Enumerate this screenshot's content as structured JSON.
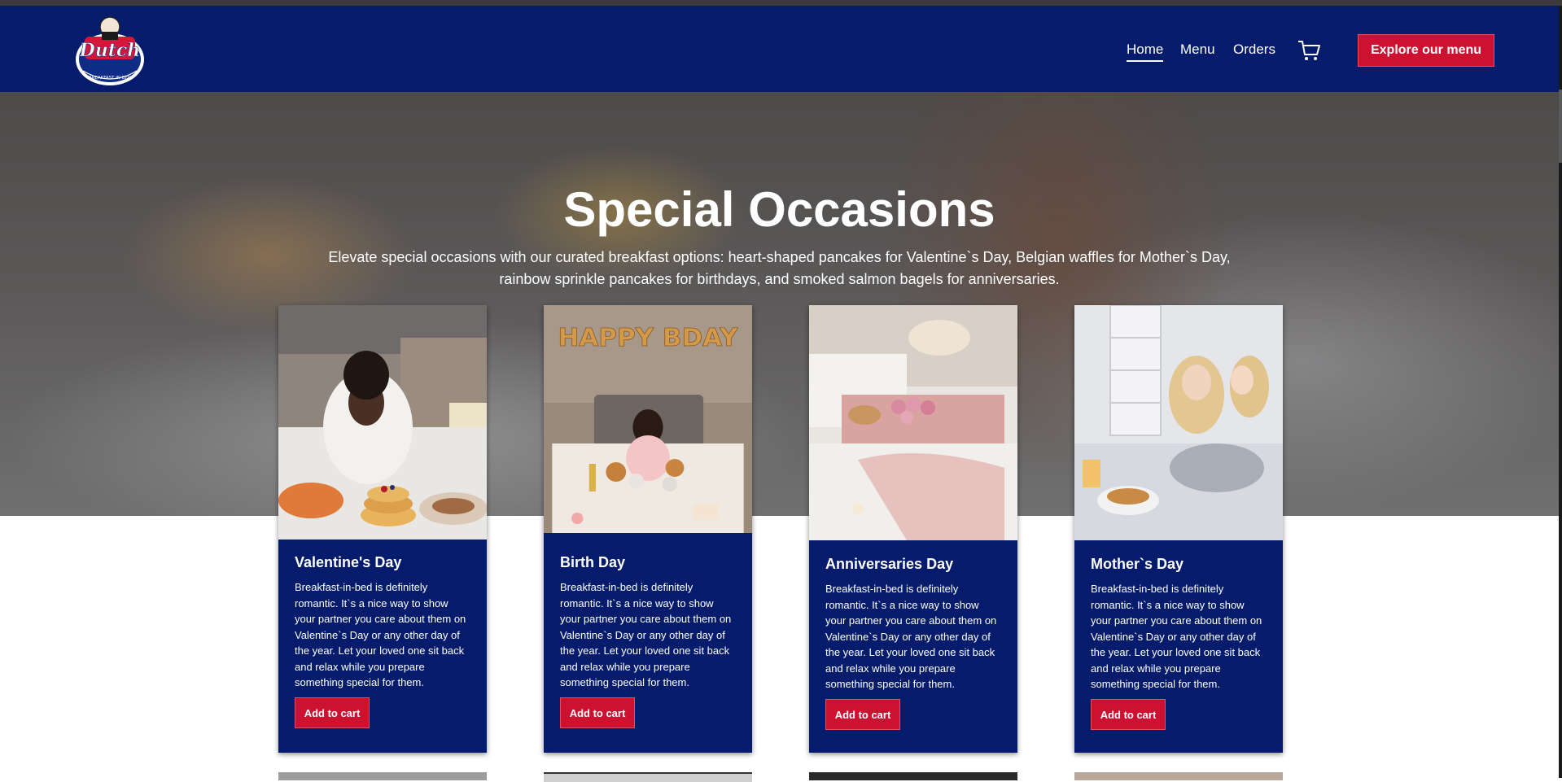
{
  "header": {
    "logo_alt": "Dutch Breakfast in Bed",
    "nav": [
      {
        "label": "Home",
        "active": true
      },
      {
        "label": "Menu",
        "active": false
      },
      {
        "label": "Orders",
        "active": false
      }
    ],
    "cart_icon": "cart-icon",
    "cta_label": "Explore our menu"
  },
  "hero": {
    "title": "Special Occasions",
    "subtitle": "Elevate special occasions with our curated breakfast options: heart-shaped pancakes for Valentine`s Day, Belgian waffles for Mother`s Day, rainbow sprinkle pancakes for birthdays, and smoked salmon bagels for anniversaries."
  },
  "cards": [
    {
      "title": "Valentine's Day",
      "text": "Breakfast-in-bed is definitely romantic. It`s a nice way to show your partner you care about them on Valentine`s Day or any other day of the year. Let your loved one sit back and relax while you prepare something special for them.",
      "button": "Add to cart"
    },
    {
      "title": "Birth Day",
      "text": "Breakfast-in-bed is definitely romantic. It`s a nice way to show your partner you care about them on Valentine`s Day or any other day of the year. Let your loved one sit back and relax while you prepare something special for them.",
      "button": "Add to cart"
    },
    {
      "title": "Anniversaries Day",
      "text": "Breakfast-in-bed is definitely romantic. It`s a nice way to show your partner you care about them on Valentine`s Day or any other day of the year. Let your loved one sit back and relax while you prepare something special for them.",
      "button": "Add to cart"
    },
    {
      "title": "Mother`s Day",
      "text": "Breakfast-in-bed is definitely romantic. It`s a nice way to show your partner you care about them on Valentine`s Day or any other day of the year. Let your loved one sit back and relax while you prepare something special for them.",
      "button": "Add to cart"
    }
  ],
  "colors": {
    "brand_blue": "#041c6b",
    "accent_red": "#cc1131"
  },
  "balloon_text": "HAPPY BDAY"
}
